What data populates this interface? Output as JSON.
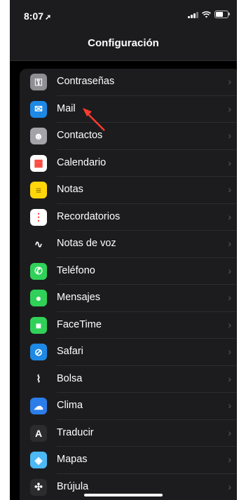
{
  "status": {
    "time": "8:07",
    "location_arrow": "➚"
  },
  "nav": {
    "title": "Configuración"
  },
  "items": [
    {
      "label": "Contraseñas",
      "icon": "key-icon",
      "color": "#8e8e93",
      "glyph": "⚿"
    },
    {
      "label": "Mail",
      "icon": "mail-icon",
      "color": "#1e88e5",
      "glyph": "✉"
    },
    {
      "label": "Contactos",
      "icon": "contacts-icon",
      "color": "#a3a3a8",
      "glyph": "☻"
    },
    {
      "label": "Calendario",
      "icon": "calendar-icon",
      "color": "#ffffff",
      "glyph": "▦"
    },
    {
      "label": "Notas",
      "icon": "notes-icon",
      "color": "#ffd60a",
      "glyph": "≡"
    },
    {
      "label": "Recordatorios",
      "icon": "reminders-icon",
      "color": "#ffffff",
      "glyph": "⋮"
    },
    {
      "label": "Notas de voz",
      "icon": "voice-memos-icon",
      "color": "#1c1c1e",
      "glyph": "∿"
    },
    {
      "label": "Teléfono",
      "icon": "phone-icon",
      "color": "#30d158",
      "glyph": "✆"
    },
    {
      "label": "Mensajes",
      "icon": "messages-icon",
      "color": "#30d158",
      "glyph": "●"
    },
    {
      "label": "FaceTime",
      "icon": "facetime-icon",
      "color": "#30d158",
      "glyph": "■"
    },
    {
      "label": "Safari",
      "icon": "safari-icon",
      "color": "#1e88e5",
      "glyph": "⊘"
    },
    {
      "label": "Bolsa",
      "icon": "stocks-icon",
      "color": "#1c1c1e",
      "glyph": "⌇"
    },
    {
      "label": "Clima",
      "icon": "weather-icon",
      "color": "#2b7de9",
      "glyph": "☁"
    },
    {
      "label": "Traducir",
      "icon": "translate-icon",
      "color": "#2c2c2e",
      "glyph": "A"
    },
    {
      "label": "Mapas",
      "icon": "maps-icon",
      "color": "#4cb8f5",
      "glyph": "◈"
    },
    {
      "label": "Brújula",
      "icon": "compass-icon",
      "color": "#2c2c2e",
      "glyph": "✣"
    }
  ],
  "chevron": "›",
  "annotation": {
    "arrow_color": "#ff3b30"
  }
}
